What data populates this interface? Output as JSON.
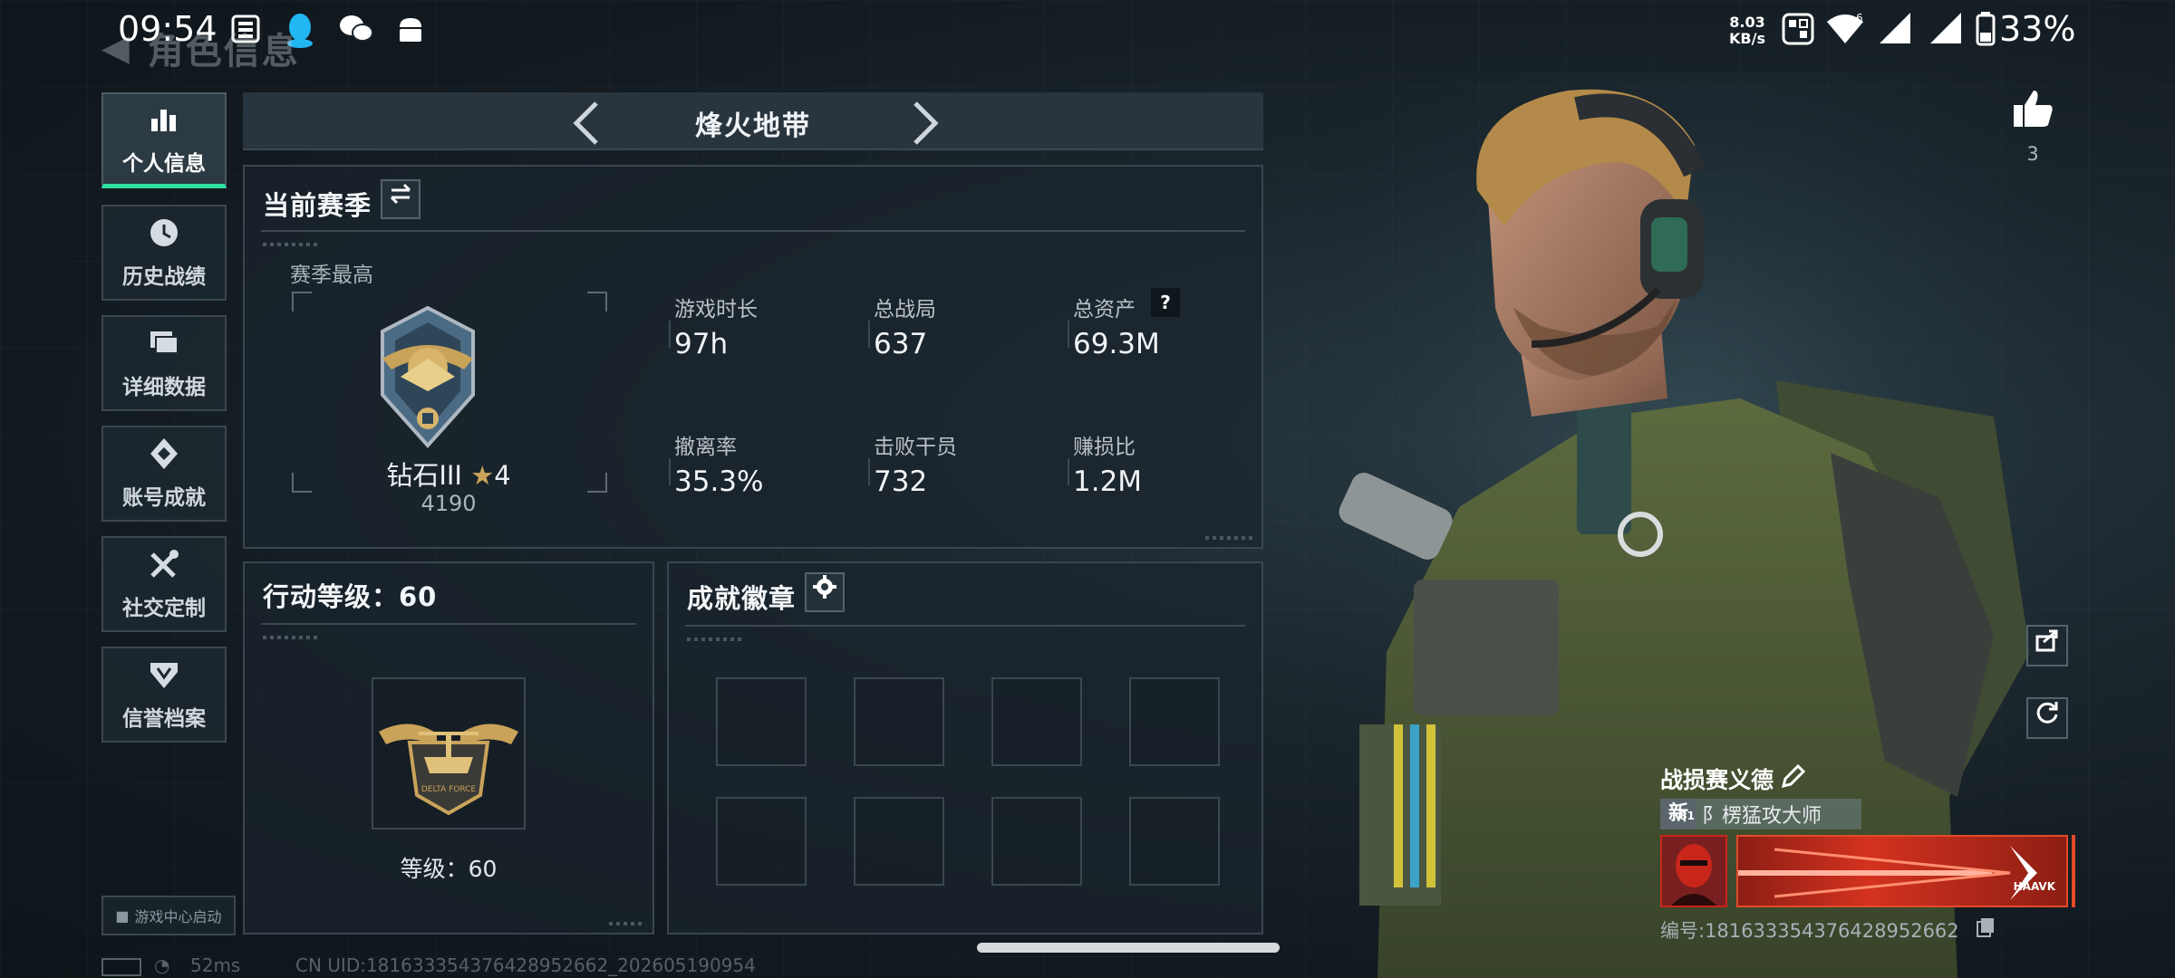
{
  "status_bar": {
    "time": "09:54",
    "net_speed_value": "8.03",
    "net_speed_unit": "KB/s",
    "battery": "33%"
  },
  "header": {
    "title": "角色信息"
  },
  "nav": [
    {
      "label": "个人信息",
      "icon": "bar-chart-icon",
      "active": true
    },
    {
      "label": "历史战绩",
      "icon": "history-clock-icon"
    },
    {
      "label": "详细数据",
      "icon": "folder-icon"
    },
    {
      "label": "账号成就",
      "icon": "achievement-icon"
    },
    {
      "label": "社交定制",
      "icon": "tools-icon"
    },
    {
      "label": "信誉档案",
      "icon": "credit-shield-icon"
    }
  ],
  "game_center_button": "游戏中心启动",
  "mode": {
    "title": "烽火地带"
  },
  "season": {
    "title": "当前赛季",
    "best_label": "赛季最高",
    "rank_name": "钻石III",
    "rank_stars": "4",
    "rank_points": "4190",
    "stats": [
      {
        "label": "游戏时长",
        "value": "97h"
      },
      {
        "label": "总战局",
        "value": "637"
      },
      {
        "label": "总资产",
        "value": "69.3M",
        "help": "?"
      },
      {
        "label": "撤离率",
        "value": "35.3%"
      },
      {
        "label": "击败干员",
        "value": "732"
      },
      {
        "label": "赚损比",
        "value": "1.2M"
      }
    ]
  },
  "level": {
    "title": "行动等级：60",
    "level_text": "等级：60",
    "emblem_text": "DELTA FORCE"
  },
  "badges": {
    "title": "成就徽章",
    "slot_count": 8
  },
  "profile": {
    "like_count": "3",
    "player_name": "战损赛义德",
    "title_tag": "新",
    "title_tag_level": "81",
    "title_text": "阝楞猛攻大师",
    "card_brand": "HAAVK",
    "serial": "编号:1816333543764289526​62"
  },
  "footer": {
    "ping": "52ms",
    "uid": "CN UID:18163335437642895​2662_202605190954"
  },
  "colors": {
    "accent": "#2fe0a1",
    "panel_border": "#3a464f",
    "card_red": "#c8261b"
  }
}
